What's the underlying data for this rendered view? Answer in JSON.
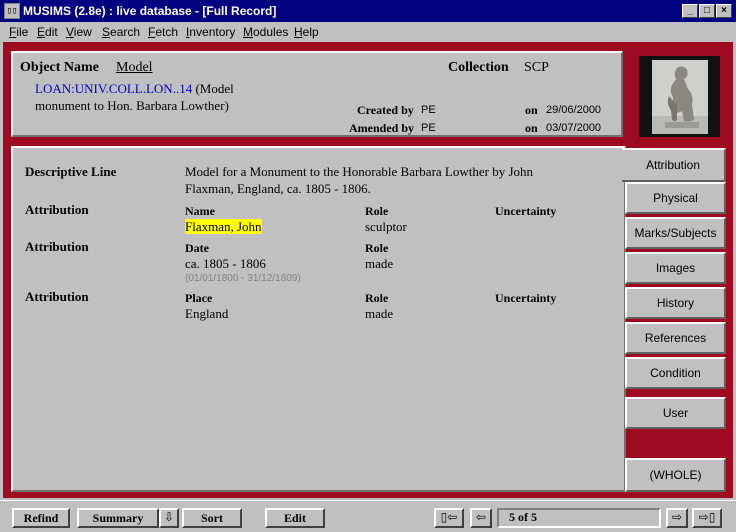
{
  "window": {
    "title": "MUSIMS (2.8e) : live database - [Full Record]",
    "controls": {
      "minimize": "_",
      "maximize": "□",
      "close": "×"
    }
  },
  "menu": [
    "File",
    "Edit",
    "View",
    "Search",
    "Fetch",
    "Inventory",
    "Modules",
    "Help"
  ],
  "header": {
    "object_name_label": "Object Name",
    "object_name_value": "Model",
    "collection_label": "Collection",
    "collection_value": "SCP",
    "identifier": "LOAN:UNIV.COLL.LON..14",
    "title_line1": " (Model",
    "title_line2": "monument to Hon. Barbara Lowther)",
    "created_by_label": "Created by",
    "created_by_value": "PE",
    "created_on_label": "on",
    "created_on_value": "29/06/2000",
    "amended_by_label": "Amended by",
    "amended_by_value": "PE",
    "amended_on_label": "on",
    "amended_on_value": "03/07/2000"
  },
  "record": {
    "descriptive_line_label": "Descriptive Line",
    "descriptive_line_1": "Model for a Monument to the Honorable Barbara Lowther by John",
    "descriptive_line_2": "Flaxman, England, ca. 1805 - 1806.",
    "attributions": [
      {
        "label": "Attribution",
        "field_label": "Name",
        "field_value": "Flaxman, John",
        "role_label": "Role",
        "role_value": "sculptor",
        "uncertainty_label": "Uncertainty"
      },
      {
        "label": "Attribution",
        "field_label": "Date",
        "field_value": "ca. 1805 - 1806",
        "field_note": "(01/01/1800 - 31/12/1809)",
        "role_label": "Role",
        "role_value": "made"
      },
      {
        "label": "Attribution",
        "field_label": "Place",
        "field_value": "England",
        "role_label": "Role",
        "role_value": "made",
        "uncertainty_label": "Uncertainty"
      }
    ]
  },
  "tabs": [
    "Attribution",
    "Physical",
    "Marks/Subjects",
    "Images",
    "History",
    "References",
    "Condition",
    "User",
    "(WHOLE)"
  ],
  "toolbar": {
    "refind": "Refind",
    "summary": "Summary",
    "sort": "Sort",
    "edit": "Edit",
    "record_counter": "5 of 5"
  },
  "colors": {
    "titlebar": "#000080",
    "frame": "#9e0a20",
    "link": "#0000cc",
    "highlight": "#ffff00"
  }
}
